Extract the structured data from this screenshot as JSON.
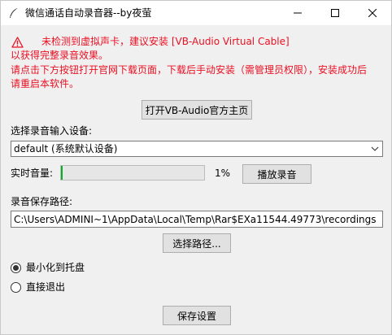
{
  "window": {
    "title": "微信通话自动录音器--by夜萤",
    "controls": {
      "minimize": "minimize",
      "maximize": "maximize",
      "close": "close"
    }
  },
  "warning": {
    "line1": "未检测到虚拟声卡，建议安装 [VB-Audio Virtual Cable]",
    "line2": "以获得完整录音效果。",
    "line3": "请点击下方按钮打开官网下载页面，下载后手动安装（需管理员权限），安装成功后",
    "line4": "请重启本软件。",
    "color": "#e81123"
  },
  "vb_button": {
    "label": "打开VB-Audio官方主页"
  },
  "device": {
    "label": "选择录音输入设备:",
    "selected": "default (系统默认设备)"
  },
  "volume": {
    "label": "实时音量:",
    "level_percent": 1,
    "readout": "1%",
    "fill_color": "#06b025",
    "play_button": "播放录音"
  },
  "save_path": {
    "label": "录音保存路径:",
    "value": "C:\\Users\\ADMINI~1\\AppData\\Local\\Temp\\Rar$EXa11544.49773\\recordings",
    "choose_button": "选择路径..."
  },
  "close_behavior": {
    "options": [
      {
        "label": "最小化到托盘",
        "selected": true
      },
      {
        "label": "直接退出",
        "selected": false
      }
    ]
  },
  "save_button": {
    "label": "保存设置"
  }
}
